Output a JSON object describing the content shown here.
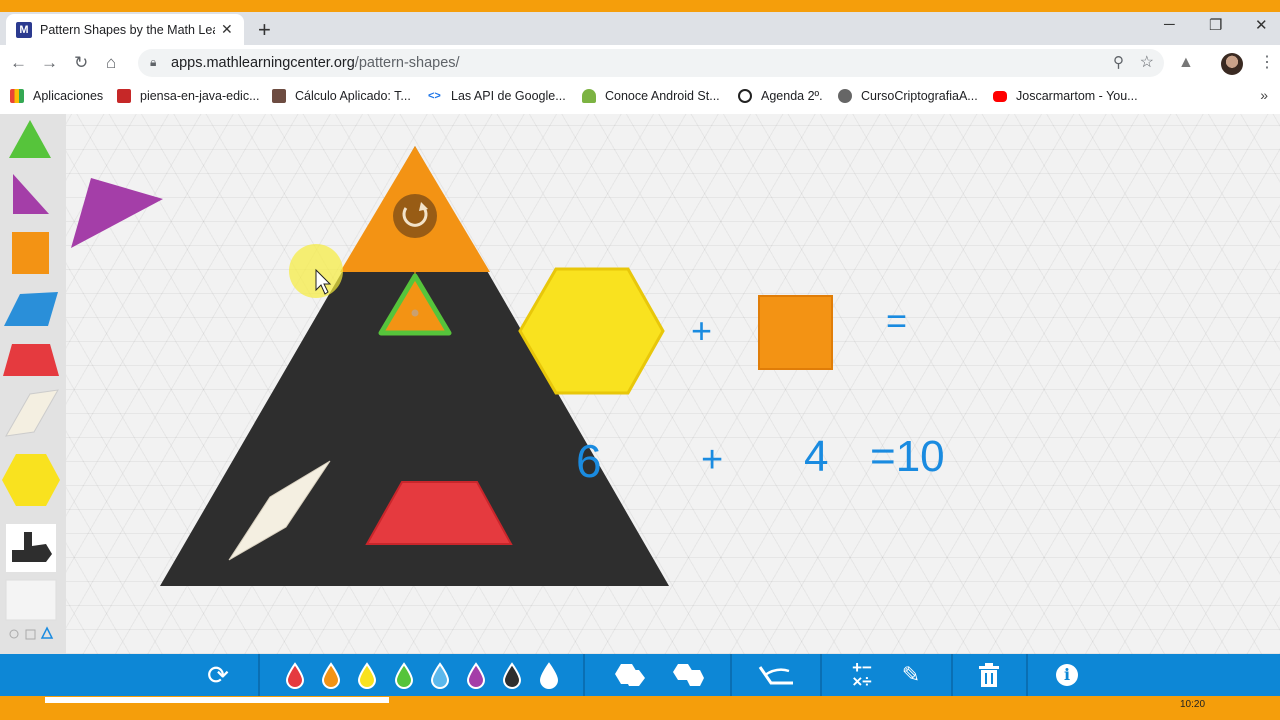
{
  "browser": {
    "tab_title": "Pattern Shapes by the Math Lear",
    "new_tab": "+",
    "close_tab": "✕",
    "url_host": "apps.mathlearningcenter.org",
    "url_path": "/pattern-shapes/",
    "window_controls": [
      "─",
      "❐",
      "✕"
    ],
    "bookmarks": [
      {
        "label": "Aplicaciones",
        "icon": "apps-grid-icon",
        "color": "#ea4335"
      },
      {
        "label": "piensa-en-java-edic...",
        "icon": "book-icon",
        "color": "#c62828"
      },
      {
        "label": "Cálculo Aplicado: T...",
        "icon": "chart-icon",
        "color": "#5d4037"
      },
      {
        "label": "Las API de Google...",
        "icon": "code-icon",
        "color": "#1a73e8"
      },
      {
        "label": "Conoce Android St...",
        "icon": "android-icon",
        "color": "#7cb342"
      },
      {
        "label": "Agenda 2º.",
        "icon": "google-icon",
        "color": "#222222"
      },
      {
        "label": "CursoCriptografiaA...",
        "icon": "globe-icon",
        "color": "#555555"
      },
      {
        "label": "Joscarmartom - You...",
        "icon": "youtube-icon",
        "color": "#ff0000"
      }
    ],
    "more_bookmarks": "»"
  },
  "equation": {
    "plus1": "+",
    "equals1": "=",
    "num1": "6",
    "plus2": "+",
    "num2": "4",
    "result": "=10"
  },
  "colors": {
    "accent": "#0d87d6",
    "orange": "#f39314",
    "yellow": "#f9e21f",
    "green": "#56c43b",
    "purple": "#a43ea8",
    "red": "#e53a3f",
    "blue": "#2a8fd9",
    "dark": "#2e2e2e",
    "equation_blue": "#1a8be0"
  },
  "toolbar": {
    "icons": [
      "rotate-icon",
      "red-drop-icon",
      "orange-drop-icon",
      "yellow-drop-icon",
      "green-drop-icon",
      "blue-drop-icon",
      "purple-drop-icon",
      "black-drop-icon",
      "white-drop-icon",
      "group-icon",
      "ungroup-icon",
      "protractor-icon",
      "math-symbols-icon",
      "pencil-icon",
      "trash-icon",
      "info-icon"
    ]
  },
  "taskbar": {
    "clock": "10:20"
  }
}
